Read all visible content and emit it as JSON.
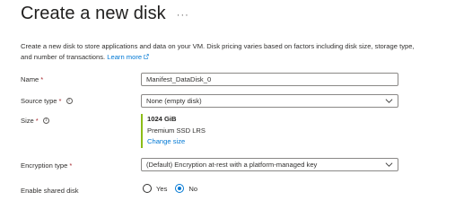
{
  "page": {
    "title": "Create a new disk",
    "more_icon": "more-ellipsis-icon"
  },
  "description": {
    "text": "Create a new disk to store applications and data on your VM. Disk pricing varies based on factors including disk size, storage type, and number of transactions.",
    "link_label": "Learn more",
    "link_icon": "external-link-icon"
  },
  "form": {
    "name": {
      "label": "Name",
      "required_mark": "*",
      "value": "Manifest_DataDisk_0"
    },
    "source_type": {
      "label": "Source type",
      "required_mark": "*",
      "value": "None (empty disk)"
    },
    "size": {
      "label": "Size",
      "required_mark": "*",
      "value": "1024 GiB",
      "sku": "Premium SSD LRS",
      "change_label": "Change size"
    },
    "encryption_type": {
      "label": "Encryption type",
      "required_mark": "*",
      "value": "(Default) Encryption at-rest with a platform-managed key"
    },
    "shared_disk": {
      "label": "Enable shared disk",
      "options": [
        "Yes",
        "No"
      ],
      "selected": "No"
    }
  },
  "colors": {
    "link": "#0078d4",
    "required": "#a4262c",
    "size_accent": "#8cbd18"
  }
}
